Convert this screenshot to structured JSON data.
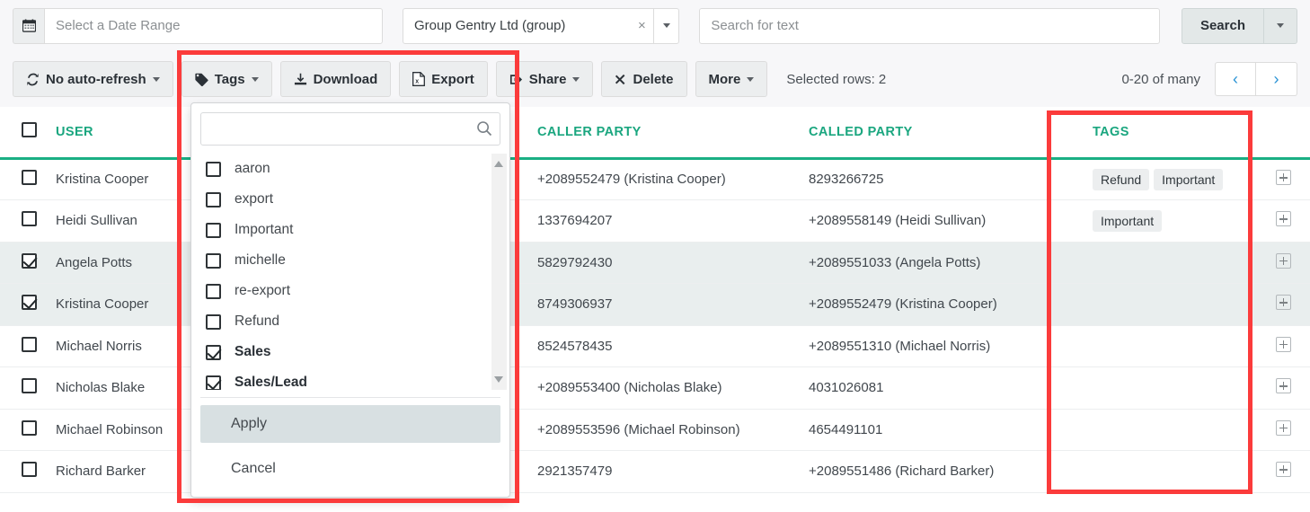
{
  "filters": {
    "calendar_icon": "calendar-icon",
    "date_placeholder": "Select a Date Range",
    "date_value": "",
    "group_value": "Group Gentry Ltd (group)",
    "group_clear_label": "×",
    "text_placeholder": "Search for text",
    "text_value": "",
    "search_label": "Search"
  },
  "toolbar": {
    "refresh_label": "No auto-refresh",
    "tags_label": "Tags",
    "download_label": "Download",
    "export_label": "Export",
    "share_label": "Share",
    "delete_label": "Delete",
    "more_label": "More",
    "selected_rows": "Selected rows: 2",
    "pager_label": "0-20 of many",
    "prev_glyph": "‹",
    "next_glyph": "›"
  },
  "tags_dropdown": {
    "search_placeholder": "",
    "search_value": "",
    "items": [
      {
        "label": "aaron",
        "checked": false
      },
      {
        "label": "export",
        "checked": false
      },
      {
        "label": "Important",
        "checked": false
      },
      {
        "label": "michelle",
        "checked": false
      },
      {
        "label": "re-export",
        "checked": false
      },
      {
        "label": "Refund",
        "checked": false
      },
      {
        "label": "Sales",
        "checked": true
      },
      {
        "label": "Sales/Lead",
        "checked": true
      }
    ],
    "apply_label": "Apply",
    "cancel_label": "Cancel"
  },
  "table": {
    "headers": {
      "user": "USER",
      "caller": "CALLER PARTY",
      "called": "CALLED PARTY",
      "tags": "TAGS"
    },
    "rows": [
      {
        "selected": false,
        "user": "Kristina Cooper",
        "caller": "+2089552479 (Kristina Cooper)",
        "called": "8293266725",
        "tags": [
          "Refund",
          "Important"
        ]
      },
      {
        "selected": false,
        "user": "Heidi Sullivan",
        "caller": "1337694207",
        "called": "+2089558149 (Heidi Sullivan)",
        "tags": [
          "Important"
        ]
      },
      {
        "selected": true,
        "user": "Angela Potts",
        "caller": "5829792430",
        "called": "+2089551033 (Angela Potts)",
        "tags": []
      },
      {
        "selected": true,
        "user": "Kristina Cooper",
        "caller": "8749306937",
        "called": "+2089552479 (Kristina Cooper)",
        "tags": []
      },
      {
        "selected": false,
        "user": "Michael Norris",
        "caller": "8524578435",
        "called": "+2089551310 (Michael Norris)",
        "tags": []
      },
      {
        "selected": false,
        "user": "Nicholas Blake",
        "caller": "+2089553400 (Nicholas Blake)",
        "called": "4031026081",
        "tags": []
      },
      {
        "selected": false,
        "user": "Michael Robinson",
        "caller": "+2089553596 (Michael Robinson)",
        "called": "4654491101",
        "tags": []
      },
      {
        "selected": false,
        "user": "Richard Barker",
        "caller": "2921357479",
        "called": "+2089551486 (Richard Barker)",
        "tags": []
      }
    ]
  },
  "colors": {
    "header_teal": "#1aa67f",
    "annotation_red": "#fb3b3b",
    "selected_row": "#e9eeee",
    "toolbar_bg": "#f7f7f9"
  }
}
